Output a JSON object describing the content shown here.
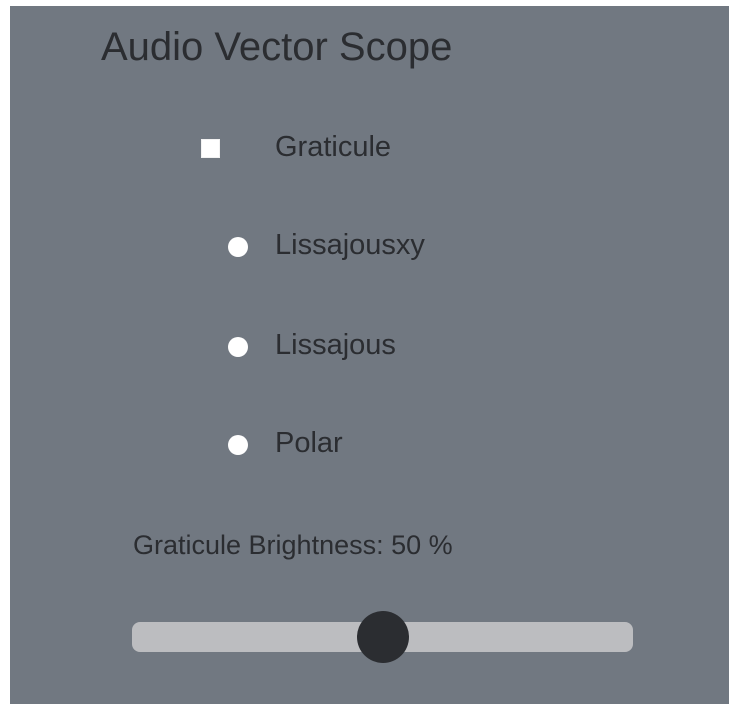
{
  "title": "Audio Vector Scope",
  "graticule": {
    "label": "Graticule",
    "checked": true
  },
  "modes": [
    {
      "label": "Lissajousxy"
    },
    {
      "label": "Lissajous"
    },
    {
      "label": "Polar"
    }
  ],
  "brightness": {
    "label": "Graticule Brightness: 50 %",
    "value": 50,
    "min": 0,
    "max": 100
  }
}
